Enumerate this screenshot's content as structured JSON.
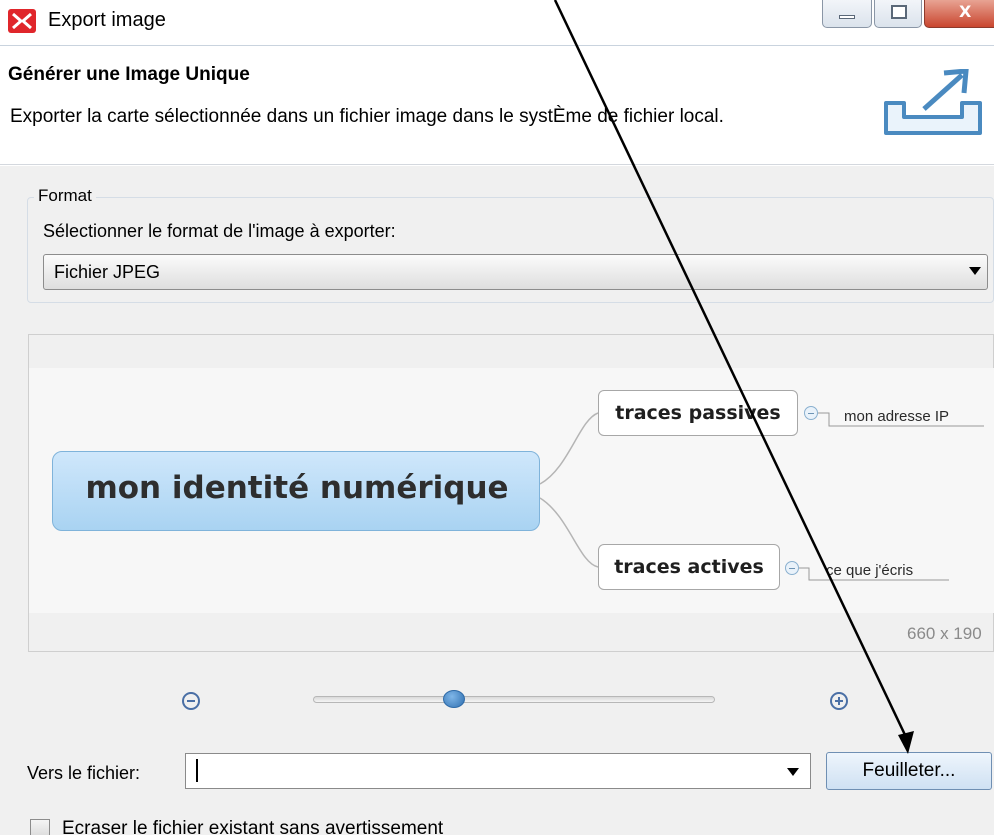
{
  "window": {
    "title": "Export image",
    "controls": {
      "minimize": "minimize-icon",
      "maximize": "maximize-icon",
      "close": "close-icon"
    }
  },
  "header": {
    "title": "Générer une Image Unique",
    "description": "Exporter la carte sélectionnée dans un fichier image dans le systÈme de fichier local.",
    "icon": "export-icon"
  },
  "format": {
    "group_label": "Format",
    "prompt": "Sélectionner le format de l'image à exporter:",
    "selected": "Fichier JPEG"
  },
  "preview": {
    "central_topic": "mon identité numérique",
    "topics": [
      {
        "label": "traces passives",
        "subtopic": "mon adresse IP"
      },
      {
        "label": "traces actives",
        "subtopic": "ce que j'écris"
      }
    ],
    "dimensions": "660 x 190",
    "central_color": "#bfe0f8"
  },
  "zoom": {
    "level_fraction": 0.35
  },
  "file": {
    "label": "Vers le fichier:",
    "value": "",
    "browse_label": "Feuilleter..."
  },
  "overwrite": {
    "label": "Ecraser le fichier existant sans avertissement",
    "checked": false
  },
  "colors": {
    "accent": "#2f6fb0",
    "app_icon": "#e0262b",
    "annotation_arrow": "#000000"
  }
}
